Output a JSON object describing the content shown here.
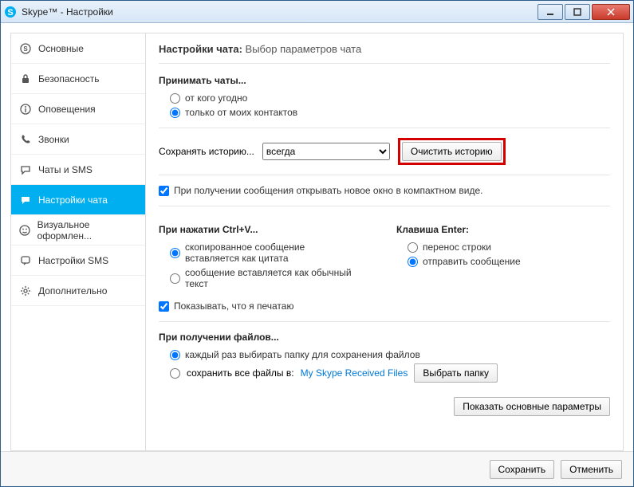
{
  "window": {
    "title": "Skype™ - Настройки"
  },
  "sidebar": {
    "items": [
      {
        "label": "Основные"
      },
      {
        "label": "Безопасность"
      },
      {
        "label": "Оповещения"
      },
      {
        "label": "Звонки"
      },
      {
        "label": "Чаты и SMS"
      },
      {
        "label": "Настройки чата"
      },
      {
        "label": "Визуальное оформлен..."
      },
      {
        "label": "Настройки SMS"
      },
      {
        "label": "Дополнительно"
      }
    ]
  },
  "main": {
    "title_bold": "Настройки чата:",
    "title_rest": "Выбор параметров чата",
    "accept_chats": {
      "heading": "Принимать чаты...",
      "opt_anyone": "от кого угодно",
      "opt_contacts": "только от моих контактов"
    },
    "history": {
      "label": "Сохранять историю...",
      "selected": "всегда",
      "clear_btn": "Очистить историю"
    },
    "compact_checkbox": "При получении сообщения открывать новое окно в компактном виде.",
    "ctrl_v": {
      "heading": "При нажатии Ctrl+V...",
      "opt_quote": "скопированное сообщение вставляется как цитата",
      "opt_plain": "сообщение вставляется как обычный текст"
    },
    "enter_key": {
      "heading": "Клавиша Enter:",
      "opt_newline": "перенос строки",
      "opt_send": "отправить сообщение"
    },
    "typing_checkbox": "Показывать, что я печатаю",
    "files": {
      "heading": "При получении файлов...",
      "opt_ask": "каждый раз выбирать папку для сохранения файлов",
      "opt_save": "сохранить все файлы в:",
      "folder_link": "My Skype Received Files",
      "choose_btn": "Выбрать папку"
    },
    "show_basic_btn": "Показать основные параметры"
  },
  "footer": {
    "save": "Сохранить",
    "cancel": "Отменить"
  }
}
